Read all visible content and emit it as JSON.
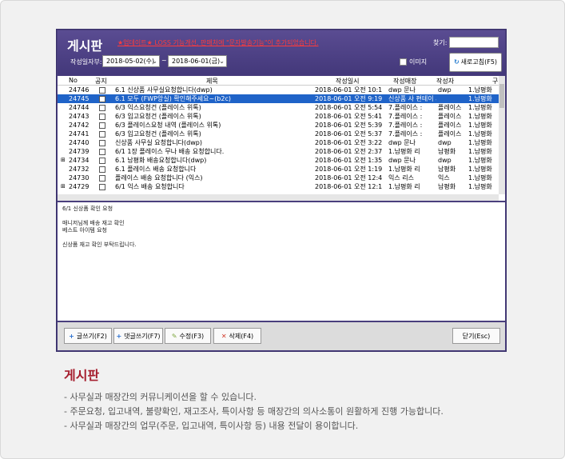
{
  "app": {
    "title": "게시판",
    "notice": "★업데이트★ LOSS 기능개선, 판매처에 \"문자발송기능\"이 추가되었습니다.",
    "find_label": "찾기:",
    "date_label": "작성일자부:",
    "date_from": "2018-05-02(수)",
    "date_tilde": "~",
    "date_to": "2018-06-01(금)",
    "image_checkbox": "이미지",
    "refresh_button": "새로고침(F5)"
  },
  "grid": {
    "headers": [
      "No",
      "공지",
      "제목",
      "작성일시",
      "작성매장",
      "작성자",
      "구"
    ],
    "rows": [
      {
        "no": "24746",
        "title": "6.1 신상품 사무실요청합니다(dwp)",
        "date": "2018-06-01 오전 10:1",
        "store": "dwp 문나",
        "writer": "dwp",
        "region": "1.남평화",
        "exp": "",
        "selected": false
      },
      {
        "no": "24745",
        "title": "6.1 모두 (FWP앙실) 확인해주세요~(b2c)",
        "date": "2018-06-01 오전 9:19",
        "store": "신상품 사 편테이 사원",
        "writer": "",
        "region": "1.남평화",
        "exp": "",
        "selected": true
      },
      {
        "no": "24744",
        "title": "6/3 익스요청건 (플레이스 위톡)",
        "date": "2018-06-01 오전 5:54",
        "store": "7.플레이스 :",
        "writer": "플레이스",
        "region": "1.남평화",
        "exp": "",
        "selected": false
      },
      {
        "no": "24743",
        "title": "6/3 입고요청건 (플레이스 위톡)",
        "date": "2018-06-01 오전 5:41",
        "store": "7.플레이스 :",
        "writer": "플레이스",
        "region": "1.남평화",
        "exp": "",
        "selected": false
      },
      {
        "no": "24742",
        "title": "6/3 플레이스요청 내역 (플레이스 위톡)",
        "date": "2018-06-01 오전 5:39",
        "store": "7.플레이스 :",
        "writer": "플레이스",
        "region": "1.남평화",
        "exp": "",
        "selected": false
      },
      {
        "no": "24741",
        "title": "6/3 입고요청건 (플레이스 위톡)",
        "date": "2018-06-01 오전 5:37",
        "store": "7.플레이스 :",
        "writer": "플레이스",
        "region": "1.남평화",
        "exp": "",
        "selected": false
      },
      {
        "no": "24740",
        "title": "신상품 사무실 요청합니다(dwp)",
        "date": "2018-06-01 오전 3:22",
        "store": "dwp 문나",
        "writer": "dwp",
        "region": "1.남평화",
        "exp": "",
        "selected": false
      },
      {
        "no": "24739",
        "title": "6/1 1장 플레이스 무나 배송 요청합니다.",
        "date": "2018-06-01 오전 2:37",
        "store": "1.남평화 리",
        "writer": "남평화",
        "region": "1.남평화",
        "exp": "",
        "selected": false
      },
      {
        "no": "24734",
        "title": "6.1 남평화 배송요청합니다(dwp)",
        "date": "2018-06-01 오전 1:35",
        "store": "dwp 문나",
        "writer": "dwp",
        "region": "1.남평화",
        "exp": "⊞",
        "selected": false
      },
      {
        "no": "24732",
        "title": "6.1 플레이스 배송 요청합니다",
        "date": "2018-06-01 오전 1:19",
        "store": "1.남평화 리",
        "writer": "남평화",
        "region": "1.남평화",
        "exp": "",
        "selected": false
      },
      {
        "no": "24730",
        "title": "플레이스 배송 요청합니다 (익스)",
        "date": "2018-06-01 오전 12:4",
        "store": "익스 리스",
        "writer": "익스",
        "region": "1.남평화",
        "exp": "",
        "selected": false
      },
      {
        "no": "24729",
        "title": "6/1 익스 배송 요청합니다",
        "date": "2018-06-01 오전 12:1",
        "store": "1.남평화 리",
        "writer": "남평화",
        "region": "1.남평화",
        "exp": "⊞",
        "selected": false
      }
    ]
  },
  "body_lines": [
    "6/1 신상품 확인 요청",
    "",
    "매니저님께 배송 재고 확인",
    "베스트 아이템 요청",
    "",
    "신상품 재고 확인 부탁드립니다."
  ],
  "toolbar": {
    "write": "글쓰기(F2)",
    "reply": "댓글쓰기(F7)",
    "edit": "수정(F3)",
    "delete": "삭제(F4)",
    "close": "닫기(Esc)"
  },
  "page": {
    "heading": "게시판",
    "lines": [
      "- 사무실과 매장간의 커뮤니케이션을 할 수 있습니다.",
      "- 주문요청, 입고내역, 불량확인, 재고조사, 특이사항 등 매장간의 의사소통이 원활하게 진행 가능합니다.",
      "- 사무실과 매장간의 업무(주문, 입고내역, 특이사항 등) 내용 전달이 용이합니다."
    ]
  },
  "colors": {
    "header": "#4a3f7d",
    "selected_row": "#1f63c8",
    "heading": "#a51d2d",
    "notice": "#ff3b3b"
  }
}
